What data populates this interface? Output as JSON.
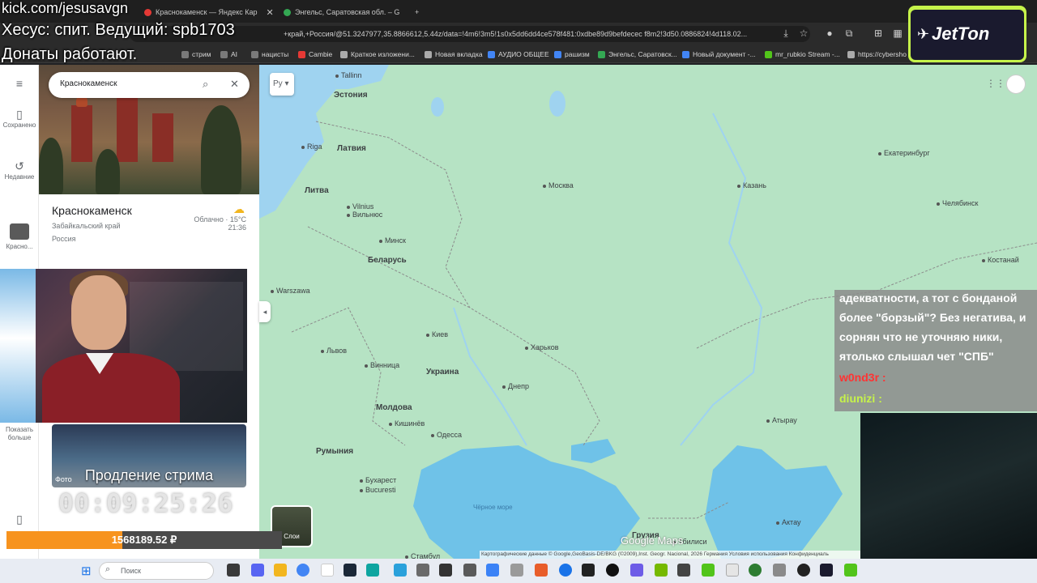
{
  "browser": {
    "tabs": [
      {
        "label": "kick.com/jesusavgn",
        "color": "#52c41a"
      },
      {
        "label": "Краснокаменск — Яндекс Кар",
        "color": "#e53935"
      },
      {
        "label": "Энгельс, Саратовская обл. – G",
        "color": "#34a853"
      }
    ],
    "new_tab": "+",
    "url": "+край,+Россия/@51.3247977,35.8866612,5.44z/data=!4m6!3m5!1s0x5dd6dd4ce578f481:0xdbe89d9befdecec f8m2!3d50.0886824!4d118.02...",
    "bookmarks": [
      {
        "label": "стрим",
        "color": "#7a7a7a"
      },
      {
        "label": "AI",
        "color": "#7a7a7a"
      },
      {
        "label": "нацисты",
        "color": "#7a7a7a"
      },
      {
        "label": "Cambie",
        "color": "#e53935"
      },
      {
        "label": "Краткое изложени...",
        "color": "#aaaaaa"
      },
      {
        "label": "Новая вкладка",
        "color": "#aaaaaa"
      },
      {
        "label": "АУДИО ОБЩЕЕ",
        "color": "#4285f4"
      },
      {
        "label": "рашизм",
        "color": "#4285f4"
      },
      {
        "label": "Энгельс, Саратовск...",
        "color": "#34a853"
      },
      {
        "label": "Новый документ -...",
        "color": "#4285f4"
      },
      {
        "label": "mr_rubkio Stream -...",
        "color": "#52c41a"
      },
      {
        "label": "https://cybersho",
        "color": "#aaaaaa"
      }
    ]
  },
  "overlay": {
    "line1": "kick.com/jesusavgn",
    "line2": "Хесус: спит. Ведущий: spb1703",
    "line3": "Донаты работают.",
    "jetton": "JetTon"
  },
  "sidebar": {
    "saved": "Сохранено",
    "recent": "Недавние",
    "current": "Красно...",
    "more": "Показать больше"
  },
  "place": {
    "search_value": "Краснокаменск",
    "title": "Краснокаменск",
    "region": "Забайкальский край",
    "country": "Россия",
    "weather": "Облачно · 15°C",
    "time": "21:36"
  },
  "stream": {
    "extension_label": "Продление стрима",
    "photo_label": "Фото",
    "timer": "00:09:25:26",
    "donation_text": "1568189.52 ₽",
    "donation_progress": 0.42
  },
  "map": {
    "lang": "Ру",
    "layers_label": "Слои",
    "attribution": "Картографические данные © Google,GeoBasis-DE/BKG (©2009),Inst. Geogr. Nacional, 2026   Германия   Условия использования   Конфиденциаль",
    "logo": "Google Maps",
    "countries": [
      "Эстония",
      "Латвия",
      "Литва",
      "Беларусь",
      "Украина",
      "Молдова",
      "Румыния",
      "Грузия"
    ],
    "cities": [
      "Tallinn",
      "Riga",
      "Vilnius",
      "Вильнюс",
      "Минск",
      "Москва",
      "Казань",
      "Екатеринбург",
      "Челябинск",
      "Костанай",
      "Warszawa",
      "Киев",
      "Львов",
      "Харьков",
      "Винница",
      "Днепр",
      "Одесса",
      "Кишинёв",
      "Бухарест",
      "Bucuresti",
      "Актау",
      "Атырау",
      "Тбилиси",
      "Стамбул"
    ],
    "sea": "Чёрное море"
  },
  "chat": {
    "lines": [
      "адекватности, а тот с бонданой",
      "более \"борзый\"? Без негатива, и",
      "сорнян что не уточняю ники,",
      "ятолько слышал чет \"СПБ\""
    ],
    "user1": "w0nd3r",
    "user2": "diunizi"
  },
  "taskbar": {
    "search": "Поиск"
  }
}
